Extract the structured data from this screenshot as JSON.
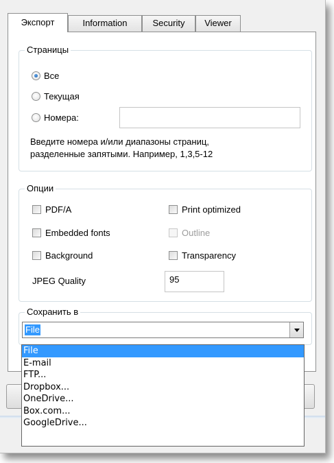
{
  "tabs": [
    "Экспорт",
    "Information",
    "Security",
    "Viewer"
  ],
  "pages_group": {
    "title": "Страницы",
    "radio_all": "Все",
    "radio_current": "Текущая",
    "radio_numbers": "Номера:",
    "numbers_value": "",
    "hint_line1": "Введите номера и/или диапазоны страниц,",
    "hint_line2": "разделенные запятыми. Например, 1,3,5-12"
  },
  "options_group": {
    "title": "Опции",
    "pdfa": "PDF/A",
    "print_optimized": "Print optimized",
    "embedded_fonts": "Embedded fonts",
    "outline": "Outline",
    "background": "Background",
    "transparency": "Transparency",
    "jpeg_quality_label": "JPEG Quality",
    "jpeg_quality_value": "95"
  },
  "save_group": {
    "title": "Сохранить в",
    "selected": "File",
    "options": [
      "File",
      "E-mail",
      "FTP...",
      "Dropbox...",
      "OneDrive...",
      "Box.com...",
      "GoogleDrive..."
    ]
  },
  "colors": {
    "accent": "#3399ff",
    "radio_dot": "#1c5eab"
  }
}
